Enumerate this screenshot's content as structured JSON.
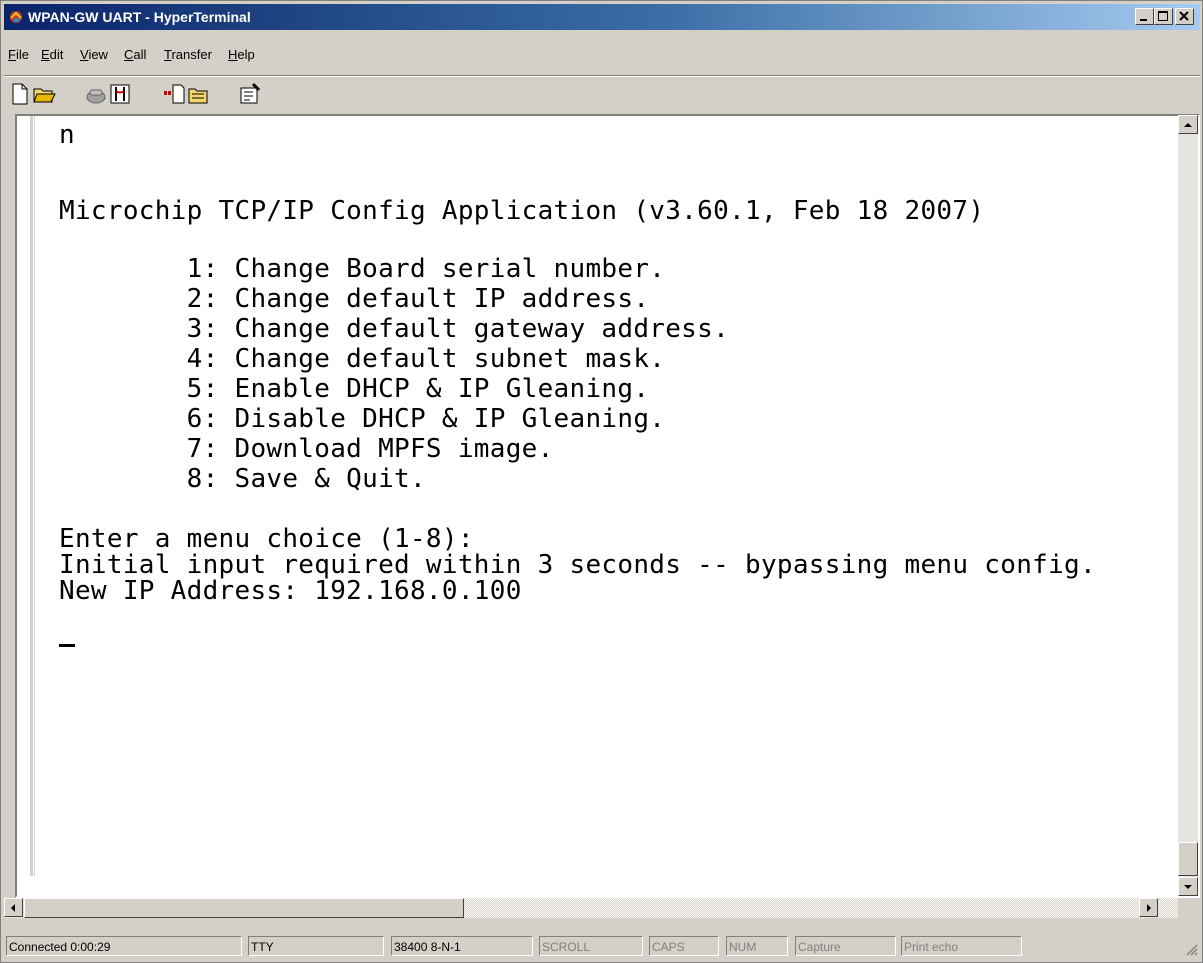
{
  "window": {
    "title": "WPAN-GW UART - HyperTerminal"
  },
  "menu": [
    {
      "label": "File",
      "key": "F",
      "rest": "ile"
    },
    {
      "label": "Edit",
      "key": "E",
      "rest": "dit"
    },
    {
      "label": "View",
      "key": "V",
      "rest": "iew"
    },
    {
      "label": "Call",
      "key": "C",
      "rest": "all"
    },
    {
      "label": "Transfer",
      "key": "T",
      "rest": "ransfer"
    },
    {
      "label": "Help",
      "key": "H",
      "rest": "elp"
    }
  ],
  "toolbar": [
    {
      "icon": "new-icon"
    },
    {
      "icon": "open-icon"
    },
    {
      "icon": "call-icon"
    },
    {
      "icon": "disconnect-icon"
    },
    {
      "icon": "send-icon"
    },
    {
      "icon": "receive-icon"
    },
    {
      "icon": "properties-icon"
    }
  ],
  "terminal": {
    "lines": [
      "n",
      "",
      "Microchip TCP/IP Config Application (v3.60.1, Feb 18 2007)",
      "",
      "        1: Change Board serial number.",
      "        2: Change default IP address.",
      "        3: Change default gateway address.",
      "        4: Change default subnet mask.",
      "        5: Enable DHCP & IP Gleaning.",
      "        6: Disable DHCP & IP Gleaning.",
      "        7: Download MPFS image.",
      "        8: Save & Quit.",
      "",
      "Enter a menu choice (1-8):",
      "Initial input required within 3 seconds -- bypassing menu config.",
      "New IP Address: 192.168.0.100"
    ]
  },
  "status": {
    "connected": "Connected 0:00:29",
    "emulation": "TTY",
    "settings": "38400 8-N-1",
    "scroll": "SCROLL",
    "caps": "CAPS",
    "num": "NUM",
    "capture": "Capture",
    "print_echo": "Print echo"
  },
  "colors": {
    "title_start": "#0a246a",
    "title_end": "#a6caf0",
    "face": "#d4d0c8"
  }
}
